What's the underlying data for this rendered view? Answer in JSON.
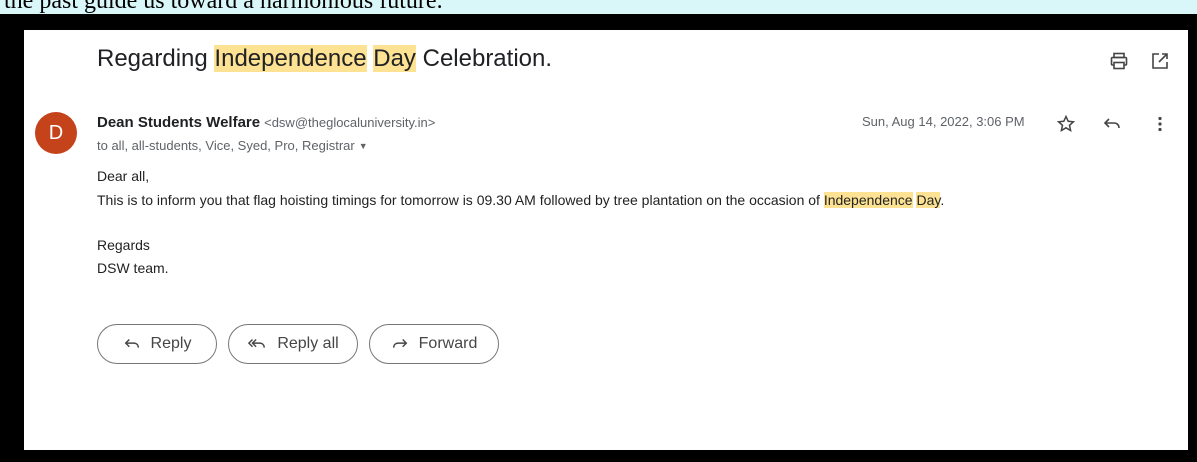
{
  "caption": {
    "text": "the past guide us toward a harmonious future."
  },
  "email": {
    "subject_parts": [
      {
        "text": "Regarding ",
        "highlight": false
      },
      {
        "text": "Independence",
        "highlight": true
      },
      {
        "text": " ",
        "highlight": false
      },
      {
        "text": "Day",
        "highlight": true
      },
      {
        "text": " Celebration.",
        "highlight": false
      }
    ],
    "avatar_letter": "D",
    "avatar_color": "#c5431b",
    "sender_name": "Dean Students Welfare",
    "sender_email": "<dsw@theglocaluniversity.in>",
    "recipients": "to all, all-students, Vice, Syed, Pro, Registrar",
    "date": "Sun, Aug 14, 2022, 3:06 PM",
    "body": {
      "greeting": "Dear all,",
      "line1_prefix": "This is to inform you that flag hoisting timings for tomorrow is 09.30 AM followed by tree plantation on the occasion of ",
      "line1_hl1": "Independence",
      "line1_space": " ",
      "line1_hl2": "Day",
      "line1_suffix": ".",
      "regards": "Regards",
      "signature": "DSW team."
    },
    "highlight_color": "#fde293"
  },
  "icons": {
    "print": "print-icon",
    "open_new_window": "open-in-new-window-icon",
    "star": "star-icon",
    "reply": "reply-icon",
    "more": "more-vertical-icon",
    "recipients_dropdown": "dropdown-caret-icon"
  },
  "actions": {
    "reply": "Reply",
    "reply_all": "Reply all",
    "forward": "Forward"
  }
}
